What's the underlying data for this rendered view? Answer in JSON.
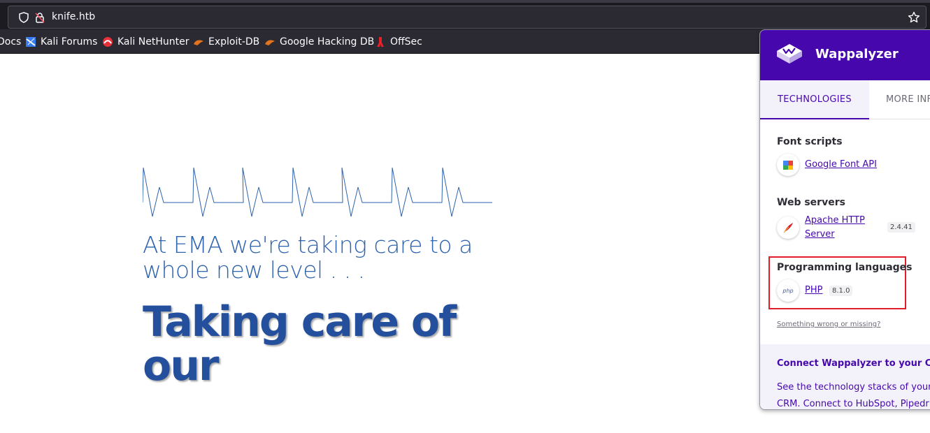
{
  "browser": {
    "url": "knife.htb",
    "bookmarks": [
      {
        "label": "Docs",
        "icon": "kali-docs-icon"
      },
      {
        "label": "Kali Forums",
        "icon": "kali-forums-icon"
      },
      {
        "label": "Kali NetHunter",
        "icon": "nethunter-icon"
      },
      {
        "label": "Exploit-DB",
        "icon": "exploit-db-icon"
      },
      {
        "label": "Google Hacking DB",
        "icon": "exploit-db-icon"
      },
      {
        "label": "OffSec",
        "icon": "offsec-icon"
      }
    ]
  },
  "page": {
    "subhead": "At EMA we're taking care to a whole new level . . .",
    "headline": "Taking care of our"
  },
  "wappalyzer": {
    "brand": "Wappalyzer",
    "tabs": [
      "TECHNOLOGIES",
      "MORE INFO"
    ],
    "categories": [
      {
        "name": "Font scripts",
        "techs": [
          {
            "name": "Google Font API",
            "version": "",
            "icon": "google-font-api-icon"
          }
        ]
      },
      {
        "name": "Web servers",
        "techs": [
          {
            "name": "Apache HTTP Server",
            "version": "2.4.41",
            "icon": "apache-feather-icon"
          }
        ]
      },
      {
        "name": "Programming languages",
        "techs": [
          {
            "name": "PHP",
            "version": "8.1.0",
            "icon": "php-icon"
          }
        ]
      }
    ],
    "missing_link": "Something wrong or missing?",
    "crm_title": "Connect Wappalyzer to your CRM",
    "crm_text_line1": "See the technology stacks of your",
    "crm_text_line2": "CRM. Connect to HubSpot, Pipedrive",
    "colors": {
      "brand": "#4608ad",
      "highlight": "#e11d2a"
    }
  }
}
